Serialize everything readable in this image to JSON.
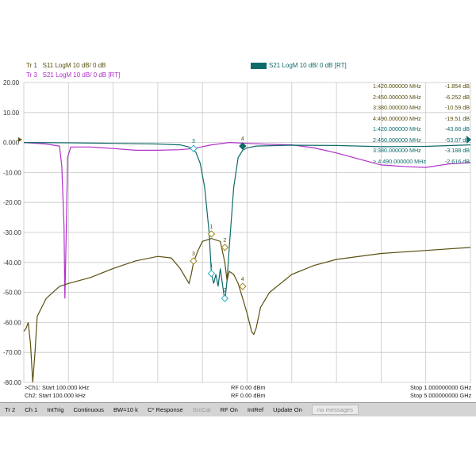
{
  "traces": {
    "tr1": {
      "id": "Tr 1",
      "label": "S11  LogM  10 dB/  0 dB",
      "color": "#5a5010"
    },
    "tr3": {
      "id": "Tr 3",
      "label": "S21  LogM  10 dB/  0 dB [RT]",
      "color": "#b030c8"
    },
    "tr2": {
      "id": "Tr 2",
      "label": "S21  LogM  10 dB/  0 dB [RT]",
      "color": "#0f6a6a"
    }
  },
  "y_axis": {
    "labels": [
      "20.00",
      "10.00",
      "0.000",
      "-10.00",
      "-20.00",
      "-30.00",
      "-40.00",
      "-50.00",
      "-60.00",
      "-70.00",
      "-80.00"
    ]
  },
  "marker_table": [
    {
      "freq": "1:420.000000 MHz",
      "value": "-1.854 dB",
      "color": "#5a5010"
    },
    {
      "freq": "2:450.000000 MHz",
      "value": "-6.252 dB",
      "color": "#5a5010"
    },
    {
      "freq": "3:380.000000 MHz",
      "value": "-10.59 dB",
      "color": "#5a5010"
    },
    {
      "freq": "4:490.000000 MHz",
      "value": "-19.51 dB",
      "color": "#5a5010"
    },
    {
      "freq": "1:420.000000 MHz",
      "value": "-43.66 dB",
      "color": "#0f6a6a"
    },
    {
      "freq": "2:450.000000 MHz",
      "value": "-53.07 dB",
      "color": "#0f6a6a"
    },
    {
      "freq": "3:380.000000 MHz",
      "value": "-3.188 dB",
      "color": "#0f6a6a"
    },
    {
      "freq": "> 4:490.000000 MHz",
      "value": "-2.616 dB",
      "color": "#0f6a6a"
    }
  ],
  "marker_labels": {
    "m1": "1",
    "m2": "2",
    "m3": "3",
    "m4": "4"
  },
  "footer": {
    "ch1_start": ">Ch1: Start 100.000 kHz",
    "ch2_start": "Ch2: Start 100.000 kHz",
    "ch1_rf": "RF 0.00 dBm",
    "ch2_rf": "RF 0.00 dBm",
    "ch1_stop": "Stop 1.000000000 GHz",
    "ch2_stop": "Stop 5.000000000 GHz"
  },
  "softkeys": [
    {
      "label": "Tr 2",
      "enabled": true
    },
    {
      "label": "Ch 1",
      "enabled": true
    },
    {
      "label": "IntTrig",
      "enabled": true
    },
    {
      "label": "Continuous",
      "enabled": true
    },
    {
      "label": "BW=10 k",
      "enabled": true
    },
    {
      "label": "C* Response",
      "enabled": true
    },
    {
      "label": "SrcCal",
      "enabled": false
    },
    {
      "label": "RF On",
      "enabled": true
    },
    {
      "label": "IntRef",
      "enabled": true
    },
    {
      "label": "Update On",
      "enabled": true
    }
  ],
  "status_message": "no messages",
  "colors": {
    "grid": "#c8c8c8",
    "trace1": "#5a5010",
    "trace2": "#0f6a6a",
    "trace3": "#b030c8",
    "marker_diamond": "#2ab0c0"
  }
}
